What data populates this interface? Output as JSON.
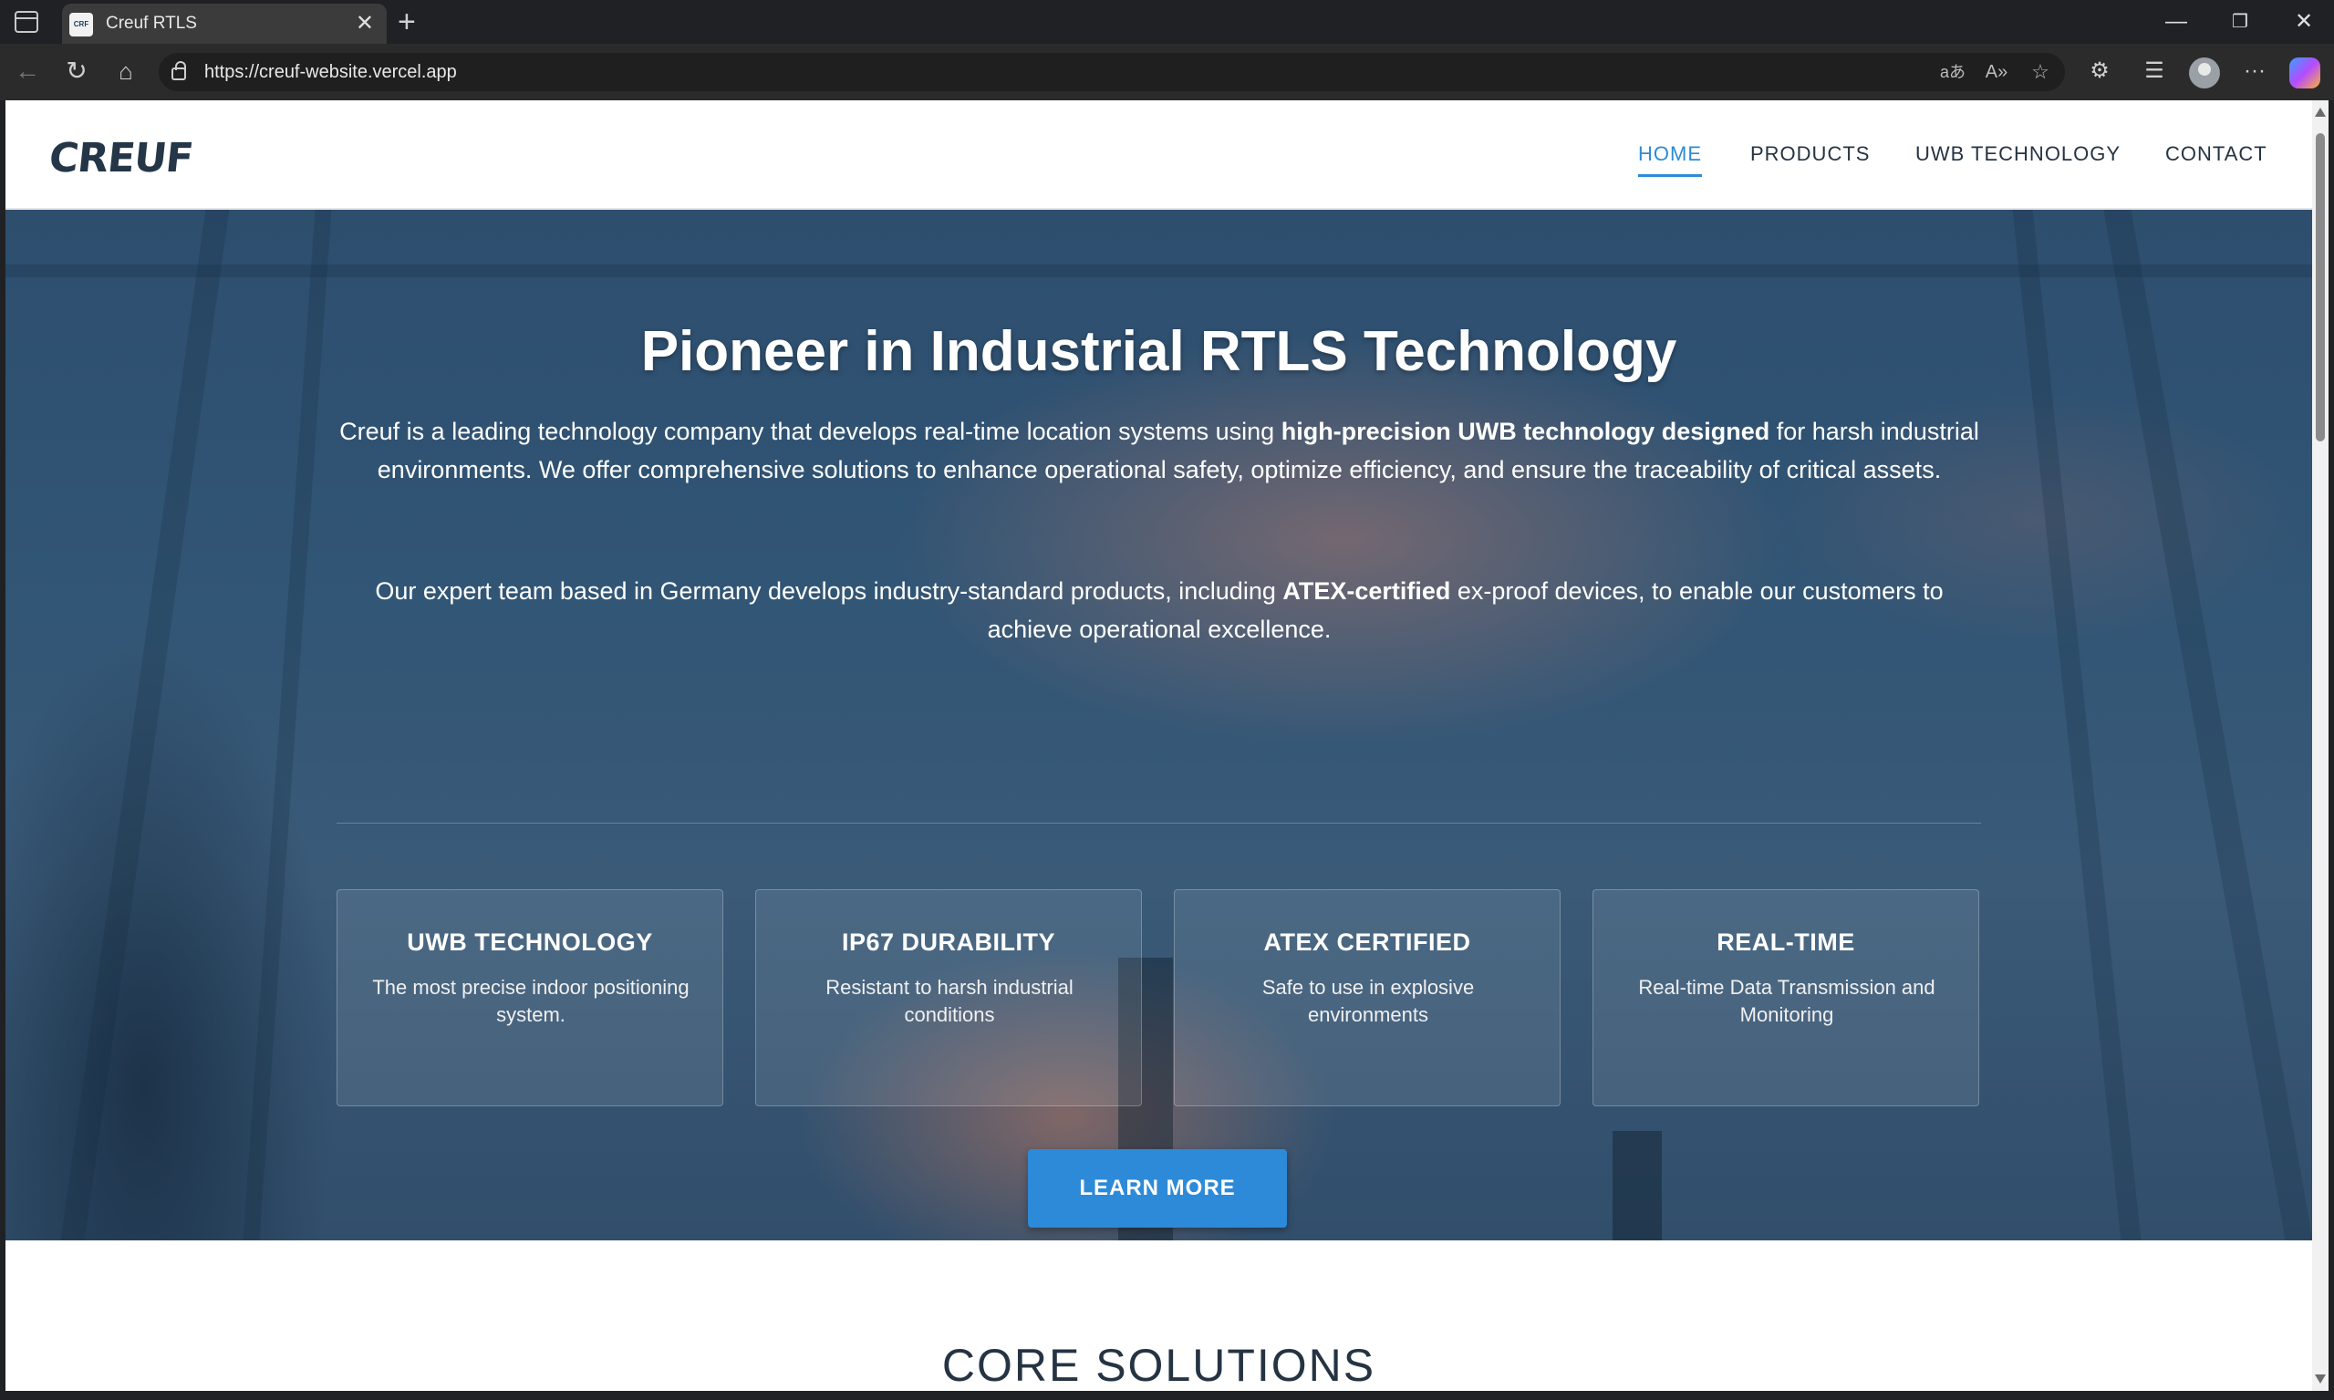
{
  "browser": {
    "tab_title": "Creuf RTLS",
    "favicon_text": "CRF",
    "url": "https://creuf-website.vercel.app",
    "new_tab_glyph": "+",
    "icons": [
      "tab-sidebar-icon",
      "close-tab-icon",
      "new-tab-icon",
      "minimize-icon",
      "restore-icon",
      "close-window-icon",
      "back-icon",
      "refresh-icon",
      "home-icon",
      "lock-icon",
      "translate-icon",
      "read-aloud-icon",
      "favorite-star-icon",
      "extensions-icon",
      "favorites-icon",
      "profile-avatar",
      "more-icon",
      "copilot-icon"
    ]
  },
  "site": {
    "logo": "CREUF",
    "nav": [
      {
        "label": "HOME",
        "active": true
      },
      {
        "label": "PRODUCTS",
        "active": false
      },
      {
        "label": "UWB TECHNOLOGY",
        "active": false
      },
      {
        "label": "CONTACT",
        "active": false
      }
    ],
    "accent_color": "#2c8bd8"
  },
  "hero": {
    "title": "Pioneer in Industrial RTLS Technology",
    "para1": {
      "a": "Creuf is a leading technology company that develops real-time location systems using ",
      "b": "high-precision UWB technology designed",
      "c": " for harsh industrial environments. We offer comprehensive solutions to enhance operational safety, optimize efficiency, and ensure the traceability of critical assets."
    },
    "para2": {
      "a": "Our expert team based in Germany develops industry-standard products, including ",
      "b": "ATEX-certified",
      "c": " ex-proof devices, to enable our customers to achieve operational excellence."
    },
    "features": [
      {
        "title": "UWB TECHNOLOGY",
        "desc": "The most precise indoor positioning system."
      },
      {
        "title": "IP67 DURABILITY",
        "desc": "Resistant to harsh industrial conditions"
      },
      {
        "title": "ATEX CERTIFIED",
        "desc": "Safe to use in explosive environments"
      },
      {
        "title": "REAL-TIME",
        "desc": "Real-time Data Transmission and Monitoring"
      }
    ],
    "cta": "LEARN MORE"
  },
  "next_section": {
    "title": "CORE SOLUTIONS"
  }
}
